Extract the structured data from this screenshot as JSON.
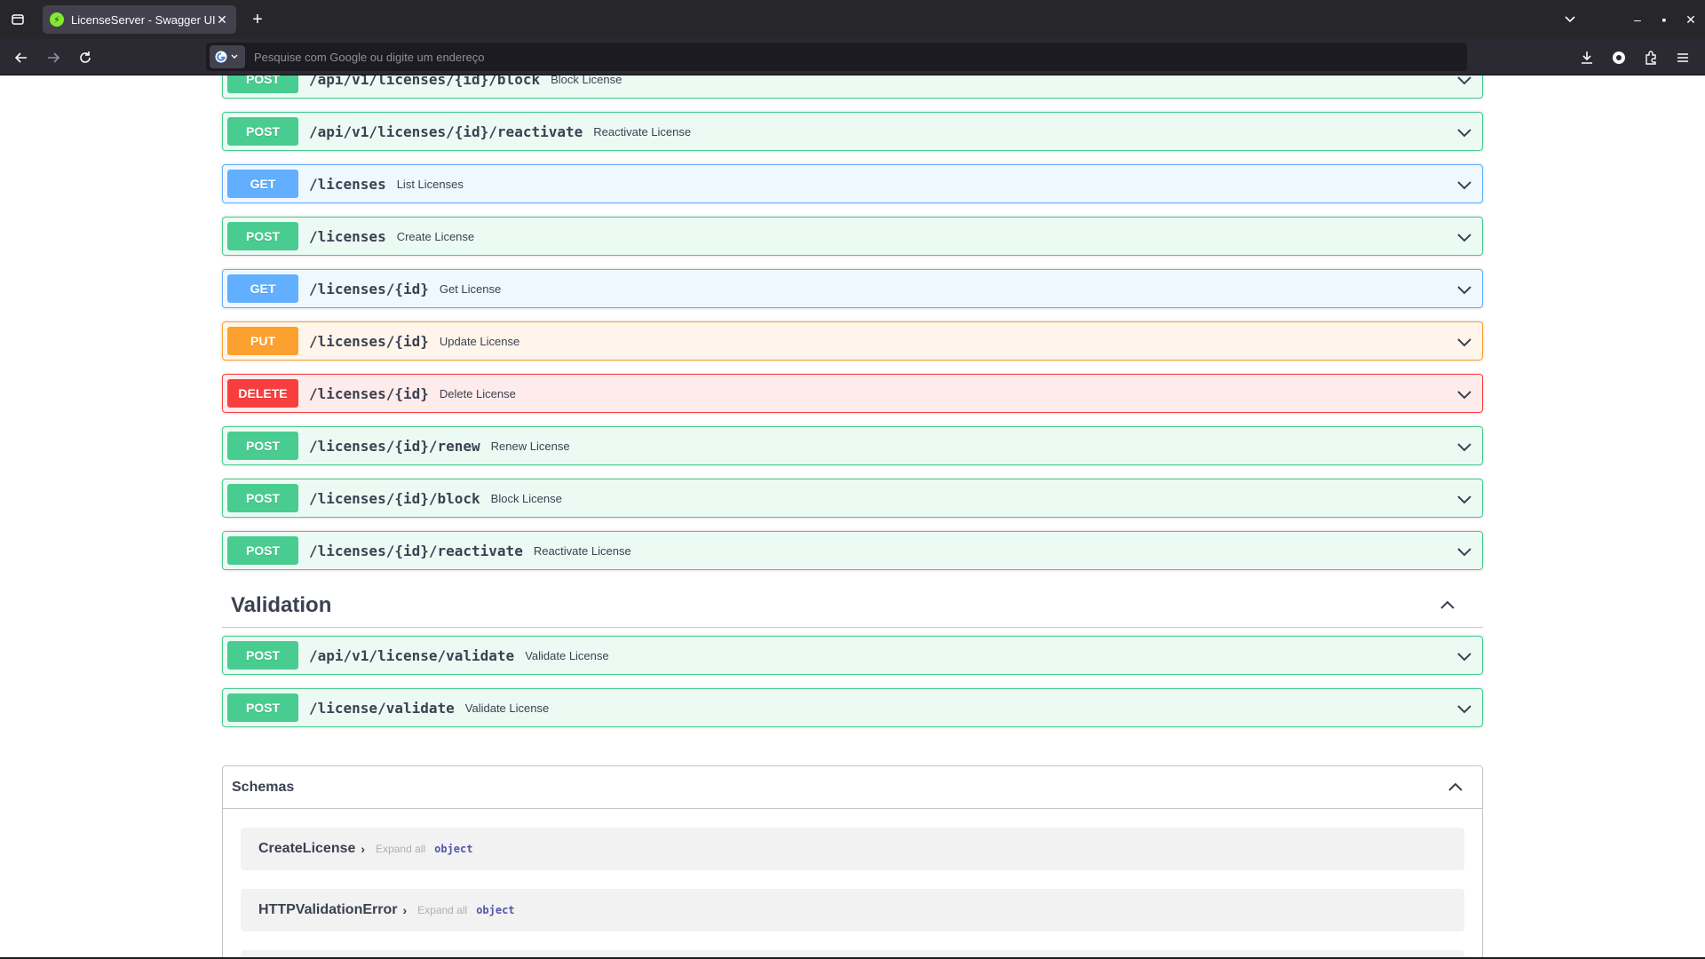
{
  "browser": {
    "tab_title": "LicenseServer - Swagger UI",
    "favicon_glyph": "⚡",
    "close_glyph": "✕",
    "new_tab_glyph": "+",
    "address_placeholder": "Pesquise com Google ou digite um endereço",
    "window_controls": {
      "minimize": "–",
      "maximize": "▪",
      "close": "✕"
    }
  },
  "operations": [
    {
      "method": "POST",
      "path": "/api/v1/licenses/{id}/block",
      "summary": "Block License"
    },
    {
      "method": "POST",
      "path": "/api/v1/licenses/{id}/reactivate",
      "summary": "Reactivate License"
    },
    {
      "method": "GET",
      "path": "/licenses",
      "summary": "List Licenses"
    },
    {
      "method": "POST",
      "path": "/licenses",
      "summary": "Create License"
    },
    {
      "method": "GET",
      "path": "/licenses/{id}",
      "summary": "Get License"
    },
    {
      "method": "PUT",
      "path": "/licenses/{id}",
      "summary": "Update License"
    },
    {
      "method": "DELETE",
      "path": "/licenses/{id}",
      "summary": "Delete License"
    },
    {
      "method": "POST",
      "path": "/licenses/{id}/renew",
      "summary": "Renew License"
    },
    {
      "method": "POST",
      "path": "/licenses/{id}/block",
      "summary": "Block License"
    },
    {
      "method": "POST",
      "path": "/licenses/{id}/reactivate",
      "summary": "Reactivate License"
    }
  ],
  "validation": {
    "title": "Validation",
    "operations": [
      {
        "method": "POST",
        "path": "/api/v1/license/validate",
        "summary": "Validate License"
      },
      {
        "method": "POST",
        "path": "/license/validate",
        "summary": "Validate License"
      }
    ]
  },
  "schemas": {
    "title": "Schemas",
    "models": [
      {
        "name": "CreateLicense",
        "arrow": "›",
        "expand": "Expand all",
        "type": "object"
      },
      {
        "name": "HTTPValidationError",
        "arrow": "›",
        "expand": "Expand all",
        "type": "object"
      }
    ]
  },
  "colors": {
    "post": "#49cc90",
    "get": "#61affe",
    "put": "#fca130",
    "delete": "#f93e3e",
    "text": "#3b4151"
  }
}
